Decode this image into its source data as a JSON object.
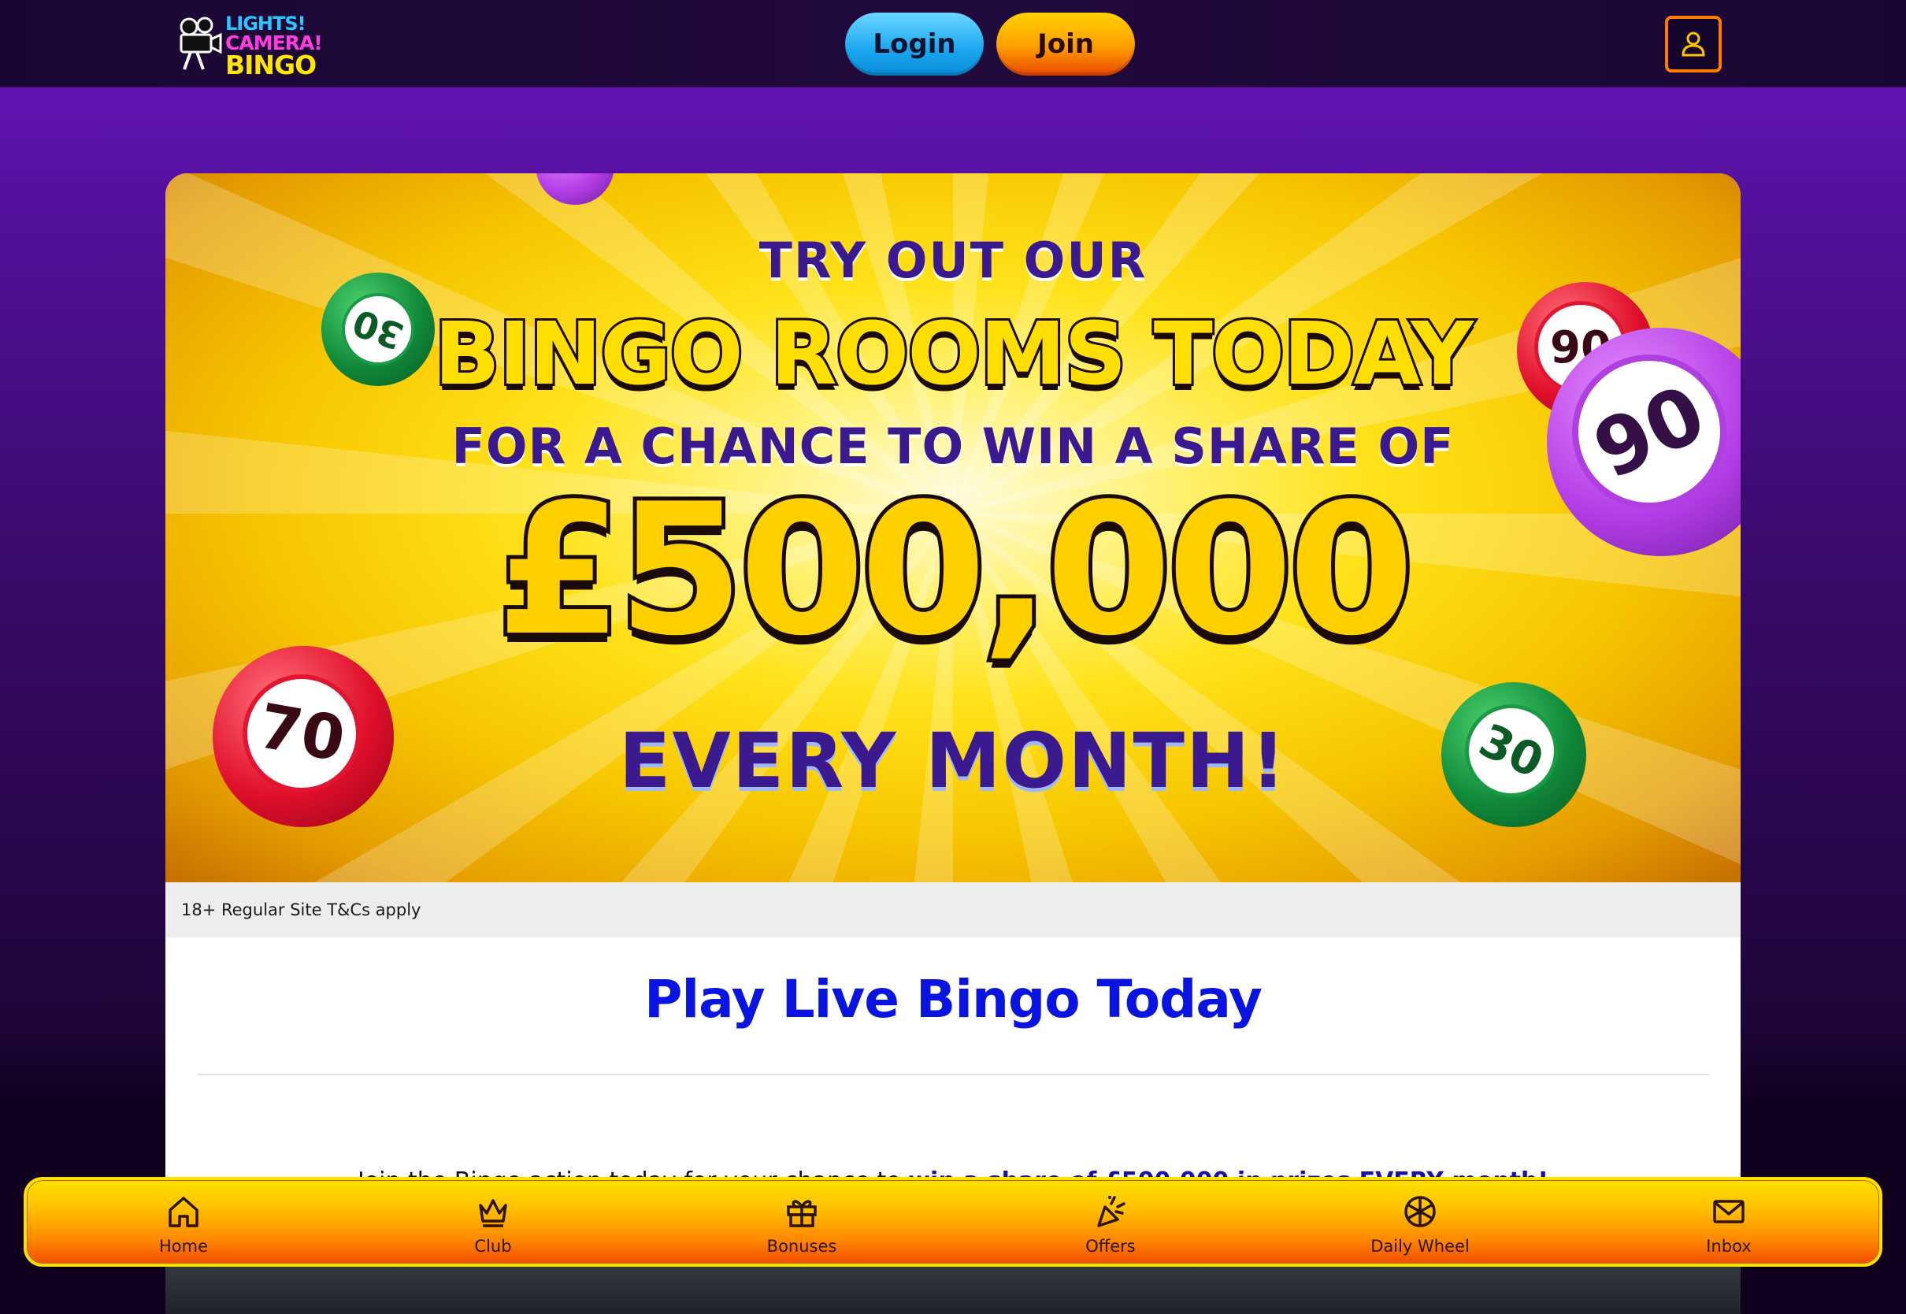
{
  "header": {
    "logo": {
      "line1": "LIGHTS!",
      "line2": "CAMERA!",
      "line3": "BINGO"
    },
    "login_label": "Login",
    "join_label": "Join",
    "account_icon": "user-icon"
  },
  "banner": {
    "line1": "TRY OUT OUR",
    "line2": "BINGO ROOMS TODAY",
    "line3": "FOR A CHANCE TO WIN A SHARE OF",
    "amount": "£500,000",
    "line5": "EVERY MONTH!",
    "balls": [
      "30",
      "70",
      "30",
      "90",
      "90"
    ],
    "tc_text": "18+ Regular Site T&Cs apply"
  },
  "content": {
    "title": "Play Live Bingo Today",
    "intro_text": "Join the Bingo action today for your chance to",
    "intro_highlight": "win a share of £500,000 in prizes EVERY month!"
  },
  "bottom_nav": {
    "items": [
      {
        "label": "Home",
        "icon": "home-icon"
      },
      {
        "label": "Club",
        "icon": "crown-icon"
      },
      {
        "label": "Bonuses",
        "icon": "gift-icon"
      },
      {
        "label": "Offers",
        "icon": "party-popper-icon"
      },
      {
        "label": "Daily Wheel",
        "icon": "wheel-icon"
      },
      {
        "label": "Inbox",
        "icon": "mail-icon"
      }
    ]
  },
  "colors": {
    "page_purple": "#6a18c2",
    "header_dark": "#1b0633",
    "login_blue": "#1aa7ef",
    "join_orange": "#ff9c00",
    "title_blue": "#0a14e0",
    "nav_yellow": "#ffe000"
  }
}
